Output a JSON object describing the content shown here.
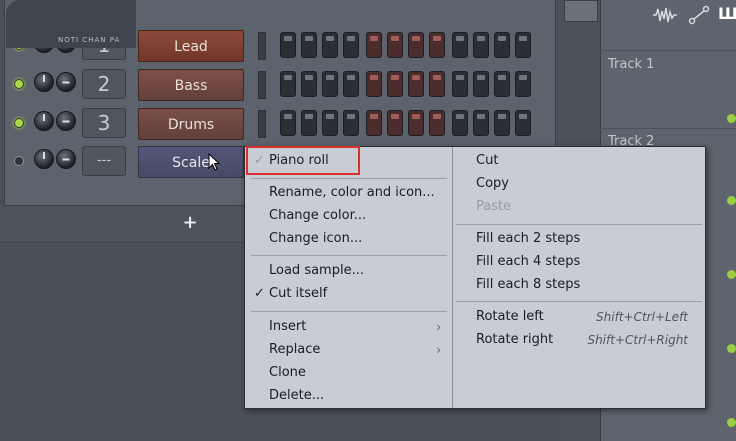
{
  "rack": {
    "add_label": "+",
    "channels": [
      {
        "number": "1",
        "name": "Lead"
      },
      {
        "number": "2",
        "name": "Bass"
      },
      {
        "number": "3",
        "name": "Drums"
      },
      {
        "number": "---",
        "name": "Scale"
      }
    ]
  },
  "playlist": {
    "tabs": "NOTI CHAN PA",
    "tracks": [
      "Track 1",
      "Track 2"
    ]
  },
  "menu": {
    "left": {
      "piano_roll": "Piano roll",
      "rename": "Rename, color and icon...",
      "change_color": "Change color...",
      "change_icon": "Change icon...",
      "load_sample": "Load sample...",
      "cut_itself": "Cut itself",
      "insert": "Insert",
      "replace": "Replace",
      "clone": "Clone",
      "delete": "Delete..."
    },
    "right": {
      "cut": "Cut",
      "copy": "Copy",
      "paste": "Paste",
      "fill2": "Fill each 2 steps",
      "fill4": "Fill each 4 steps",
      "fill8": "Fill each 8 steps",
      "rotate_left": "Rotate left",
      "rotate_left_shortcut": "Shift+Ctrl+Left",
      "rotate_right": "Rotate right",
      "rotate_right_shortcut": "Shift+Ctrl+Right"
    },
    "check_glyph": "✓",
    "submenu_glyph": "›"
  },
  "colors": {
    "highlight_box": "#d8302e",
    "led_on": "#a7d84b"
  }
}
